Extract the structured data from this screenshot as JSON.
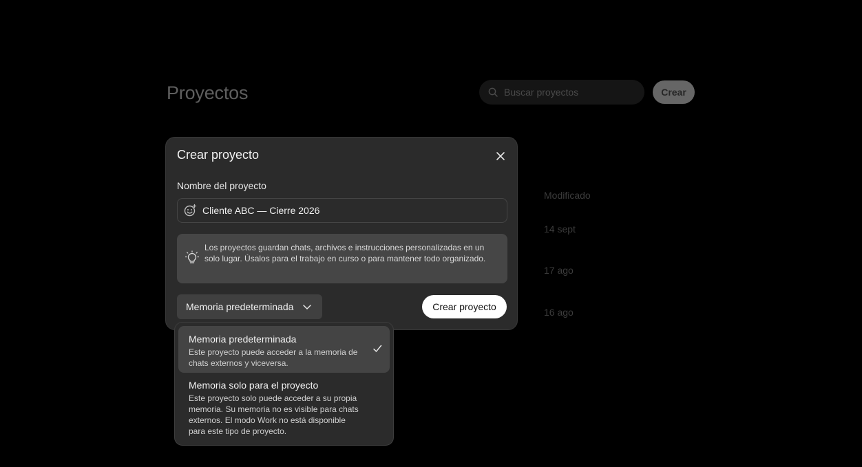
{
  "background": {
    "page_title": "Proyectos",
    "search_placeholder": "Buscar proyectos",
    "create_button": "Crear",
    "column_header": "Modificado",
    "dates": [
      "14 sept",
      "17 ago",
      "16 ago"
    ]
  },
  "modal": {
    "title": "Crear proyecto",
    "name_label": "Nombre del proyecto",
    "name_value": "Cliente ABC — Cierre 2026",
    "info_text": "Los proyectos guardan chats, archivos e instrucciones personalizadas en un solo lugar. Úsalos para el trabajo en curso o para mantener todo organizado.",
    "memory_selected": "Memoria predeterminada",
    "create_button": "Crear proyecto"
  },
  "dropdown": {
    "options": [
      {
        "title": "Memoria predeterminada",
        "description": "Este proyecto puede acceder a la memoria de chats externos y viceversa.",
        "selected": true
      },
      {
        "title": "Memoria solo para el proyecto",
        "description": "Este proyecto solo puede acceder a su propia memoria. Su memoria no es visible para chats externos. El modo Work no está disponible para este tipo de proyecto.",
        "selected": false
      }
    ]
  },
  "colors": {
    "background": "#000000",
    "modal_bg": "#2b2b2b",
    "info_bg": "#464646",
    "primary_button": "#ffffff"
  },
  "icons": [
    "search-icon",
    "close-icon",
    "emoji-icon",
    "lightbulb-icon",
    "chevron-down-icon",
    "checkmark-icon"
  ]
}
